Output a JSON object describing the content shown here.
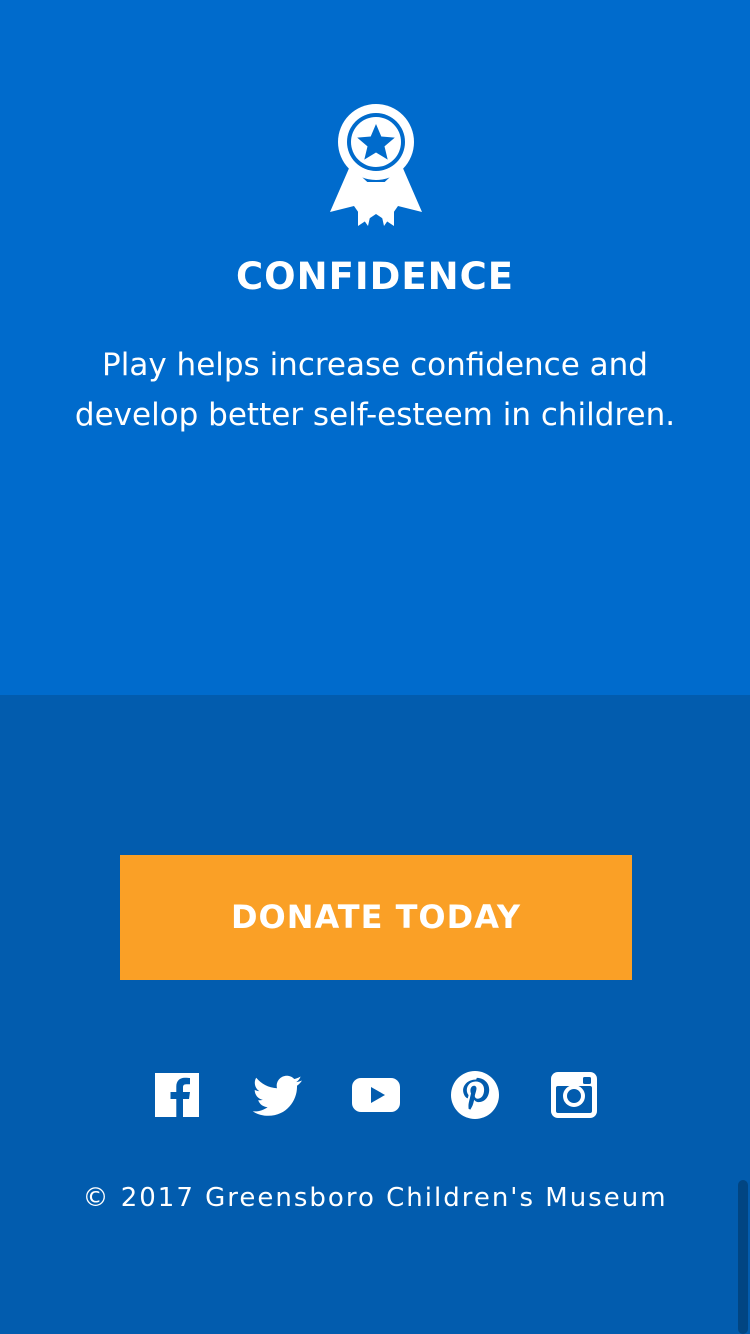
{
  "hero": {
    "icon": "award-ribbon-icon",
    "title": "CONFIDENCE",
    "text": "Play helps increase confidence and develop better self-esteem in children.",
    "background": "#006bcc"
  },
  "footer": {
    "background": "#025cae",
    "donate_label": "DONATE TODAY",
    "donate_color": "#faa026",
    "social": [
      {
        "name": "facebook-icon"
      },
      {
        "name": "twitter-icon"
      },
      {
        "name": "youtube-icon"
      },
      {
        "name": "pinterest-icon"
      },
      {
        "name": "instagram-icon"
      }
    ],
    "copyright": "© 2017 Greensboro Children's Museum"
  }
}
